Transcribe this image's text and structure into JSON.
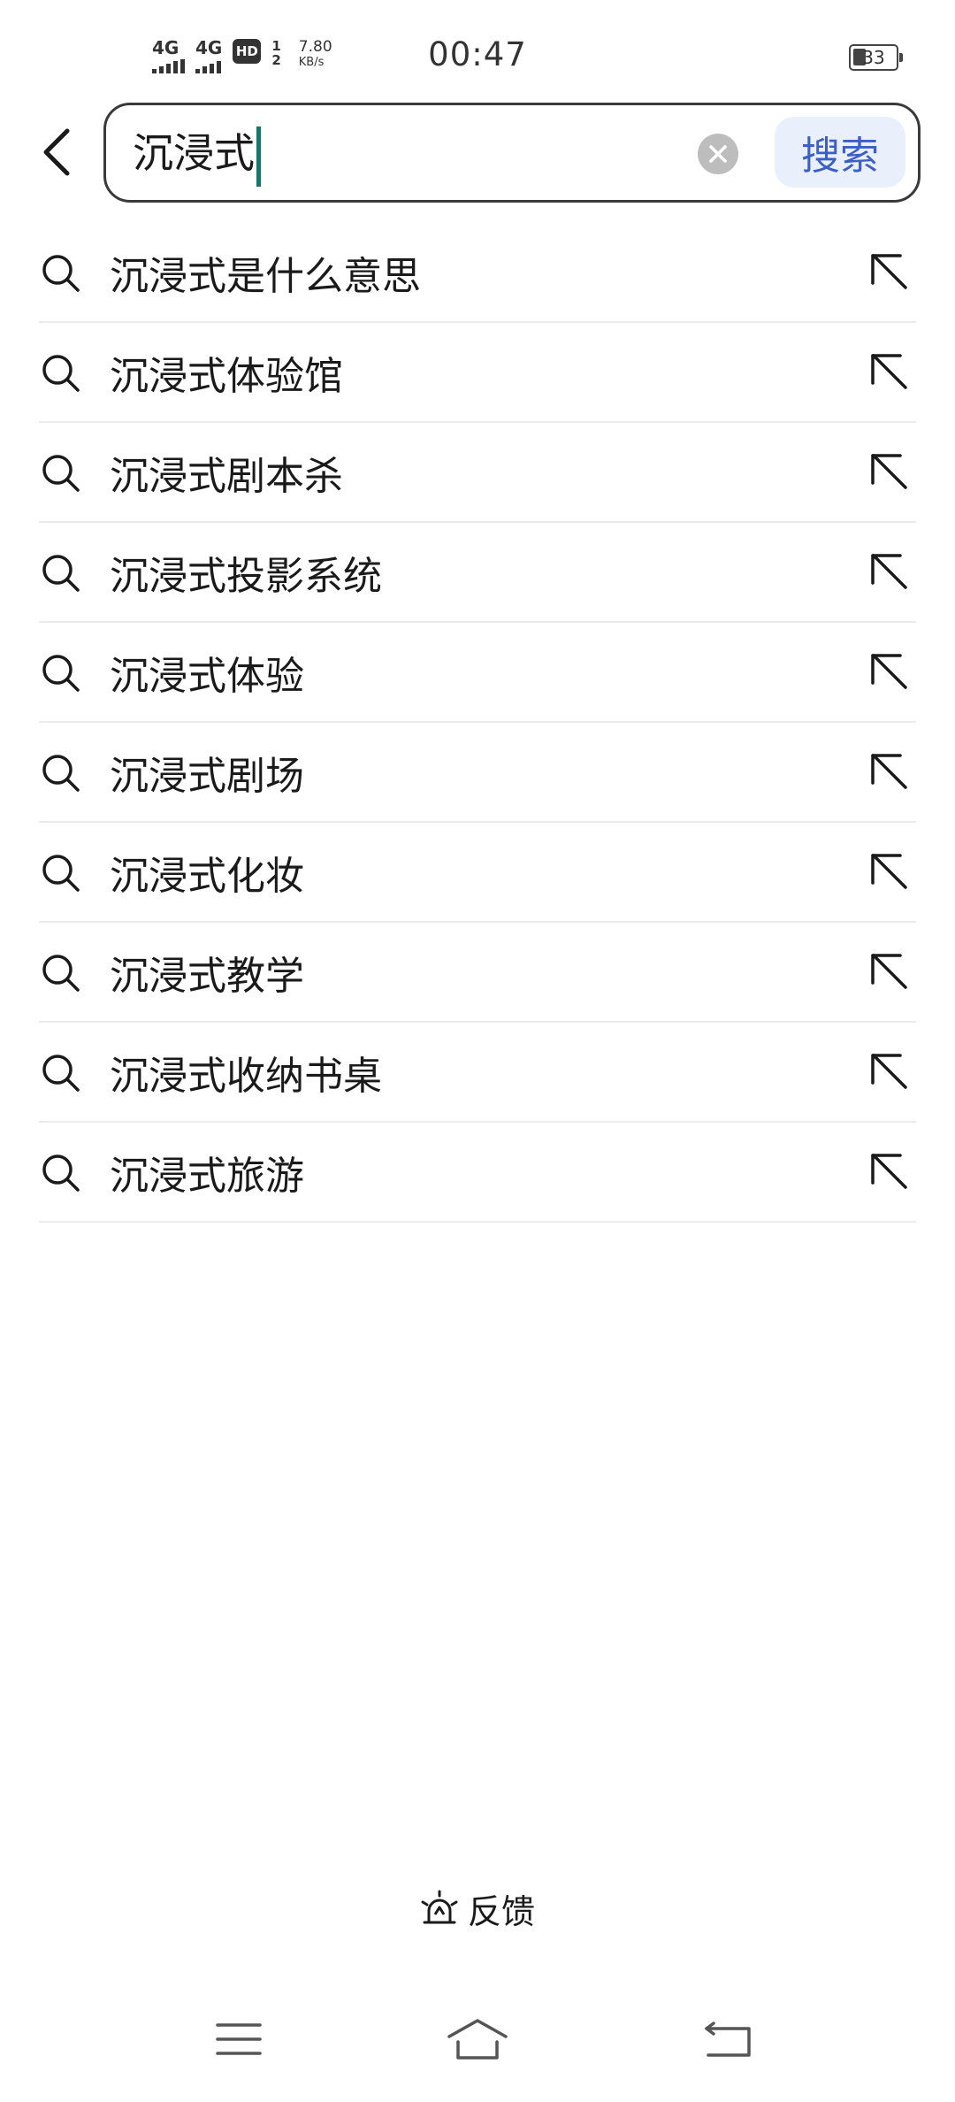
{
  "status_bar": {
    "sim1_label": "4G",
    "sim2_label": "4G",
    "hd_label": "HD",
    "hd_sub_top": "1",
    "hd_sub_bottom": "2",
    "speed_value": "7.80",
    "speed_unit": "KB/s",
    "time": "00:47",
    "battery": "33"
  },
  "search": {
    "query": "沉浸式",
    "search_button_label": "搜索",
    "accent_color": "#3c5fc4",
    "caret_color": "#0f7a6a"
  },
  "suggestions": [
    "沉浸式是什么意思",
    "沉浸式体验馆",
    "沉浸式剧本杀",
    "沉浸式投影系统",
    "沉浸式体验",
    "沉浸式剧场",
    "沉浸式化妆",
    "沉浸式教学",
    "沉浸式收纳书桌",
    "沉浸式旅游"
  ],
  "feedback": {
    "label": "反馈"
  },
  "icons": {
    "back": "chevron-left-icon",
    "clear": "close-circle-icon",
    "suggestion": "search-icon",
    "fill": "arrow-up-left-icon",
    "feedback": "alarm-light-icon",
    "nav_menu": "menu-icon",
    "nav_home": "home-icon",
    "nav_back": "back-icon"
  }
}
